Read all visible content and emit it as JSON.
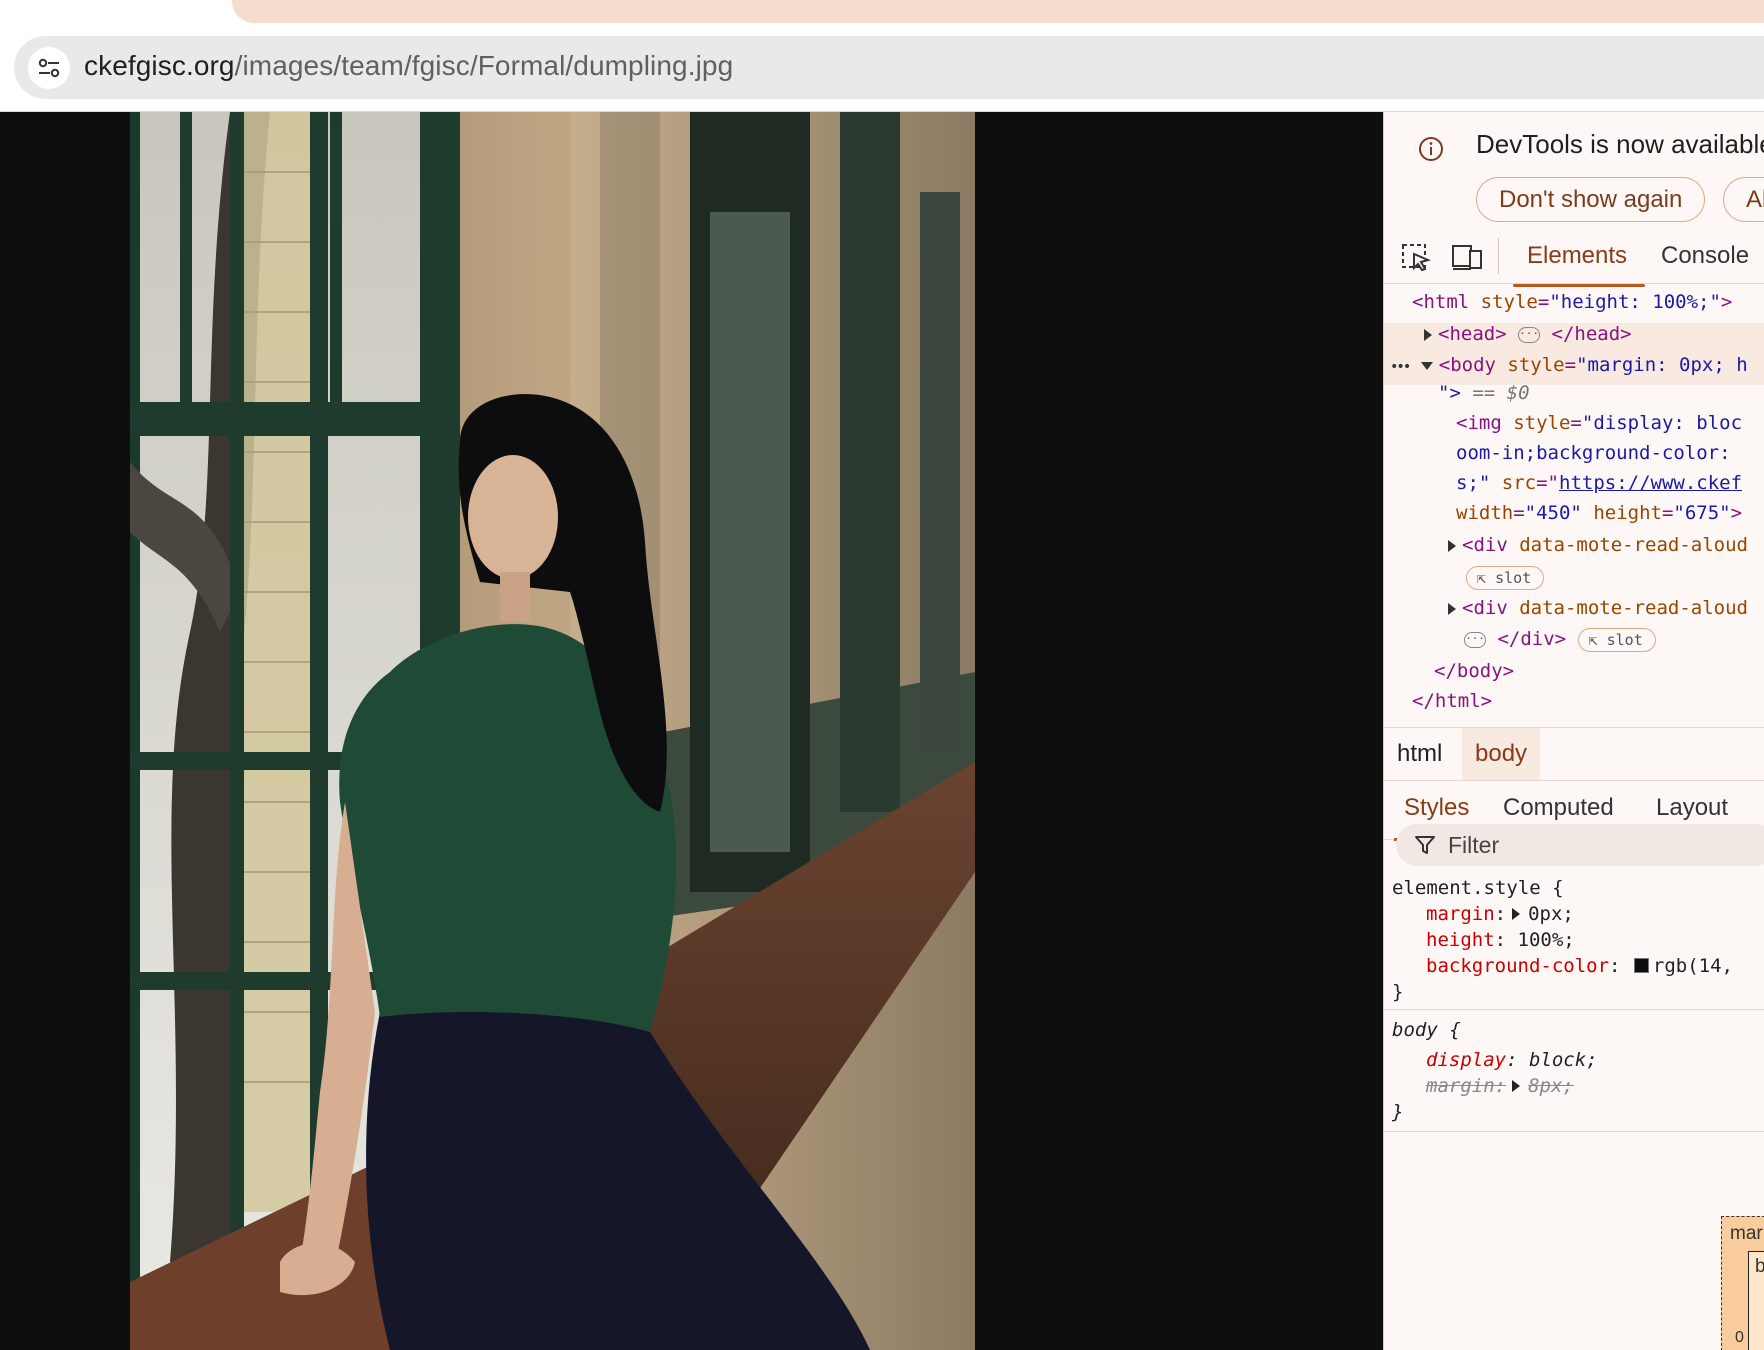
{
  "browser": {
    "url_host": "ckefgisc.org",
    "url_path": "/images/team/fgisc/Formal/dumpling.jpg"
  },
  "page": {
    "background_color": "#0e0e0e",
    "image_alt": "Portrait photo: a student in a green short-sleeve shirt and dark pleated skirt sitting on a wooden windowsill beside tall green-framed windows in a long corridor"
  },
  "devtools": {
    "info_message": "DevTools is now available",
    "buttons": {
      "dont_show": "Don't show again",
      "always": "Al"
    },
    "tabs": {
      "elements": "Elements",
      "console": "Console"
    },
    "dom": {
      "line1_tag_open": "<html",
      "line1_attr": "style",
      "line1_val": "\"height: 100%;\"",
      "line1_close": ">",
      "line2_open": "<head>",
      "line2_close": "</head>",
      "line3_prefix": "•••",
      "line3_tag_open": "<body",
      "line3_attr": "style",
      "line3_val": "\"margin: 0px; h",
      "line4_val": "\">",
      "line4_eq": "== $0",
      "line5_tag_open": "<img",
      "line5_attr": "style",
      "line5_val": "\"display: bloc",
      "line6_val": "oom-in;background-color:",
      "line7_val": "s;\"",
      "line7_attr": "src",
      "line7_eq": "=\"",
      "line7_link": "https://www.ckef",
      "line8_attr_w": "width",
      "line8_val_w": "\"450\"",
      "line8_attr_h": "height",
      "line8_val_h": "\"675\"",
      "line8_close": ">",
      "line9_tag": "<div",
      "line9_attr": "data-mote-read-aloud",
      "slot_label": "slot",
      "line11_tag": "<div",
      "line11_attr": "data-mote-read-aloud",
      "line12_close": "</div>",
      "line13_close": "</body>",
      "line14_close": "</html>"
    },
    "breadcrumbs": [
      "html",
      "body"
    ],
    "style_tabs": [
      "Styles",
      "Computed",
      "Layout"
    ],
    "filter_placeholder": "Filter",
    "styles": {
      "rule1_selector": "element.style {",
      "rule1_props": [
        {
          "name": "margin",
          "value": "0px;"
        },
        {
          "name": "height",
          "value": "100%;"
        },
        {
          "name": "background-color",
          "value": "rgb(14,"
        }
      ],
      "close_brace": "}",
      "rule2_selector": "body {",
      "rule2_prop1_name": "display",
      "rule2_prop1_value": "block;",
      "rule2_prop2_name": "margin",
      "rule2_prop2_value": "8px;"
    },
    "boxmodel": {
      "outer_label": "mar",
      "inner_label": "b",
      "zero": "0"
    }
  },
  "colors": {
    "accent": "#b8581f",
    "tab_highlight": "#f6dccc",
    "devtools_bg": "#fdf8f6"
  }
}
